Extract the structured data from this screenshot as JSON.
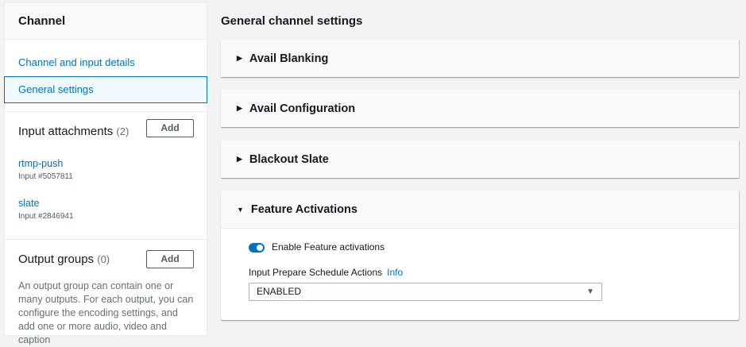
{
  "sidebar": {
    "title": "Channel",
    "nav": [
      "Channel and input details",
      "General settings"
    ],
    "inputs": {
      "label": "Input attachments",
      "count": "(2)",
      "add": "Add",
      "items": [
        {
          "name": "rtmp-push",
          "id": "Input #5057811"
        },
        {
          "name": "slate",
          "id": "Input #2846941"
        }
      ]
    },
    "outputs": {
      "label": "Output groups",
      "count": "(0)",
      "add": "Add",
      "description": "An output group can contain one or many outputs. For each output, you can configure the encoding settings, and add one or more audio, video and caption"
    }
  },
  "main": {
    "title": "General channel settings",
    "panels": [
      "Avail Blanking",
      "Avail Configuration",
      "Blackout Slate",
      "Feature Activations"
    ],
    "feature": {
      "toggle_label": "Enable Feature activations",
      "toggle_on": true,
      "field_label": "Input Prepare Schedule Actions",
      "info": "Info",
      "select_value": "ENABLED"
    }
  }
}
